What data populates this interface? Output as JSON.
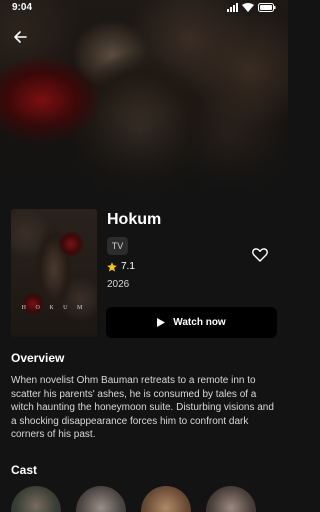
{
  "status": {
    "time": "9:04"
  },
  "movie": {
    "title": "Hokum",
    "poster_text": "H O K U M",
    "type": "TV",
    "rating": "7.1",
    "year": "2026",
    "watch_label": "Watch now"
  },
  "overview": {
    "title": "Overview",
    "text": "When novelist Ohm Bauman retreats to a remote inn to scatter his parents' ashes, he is consumed by tales of a witch haunting the honeymoon suite. Disturbing visions and a shocking disappearance forces him to confront dark corners of his past."
  },
  "cast": {
    "title": "Cast"
  },
  "colors": {
    "background": "#131313",
    "star": "#f5c518",
    "button": "#000000"
  },
  "icons": [
    "back-arrow-icon",
    "heart-icon",
    "star-icon",
    "play-icon",
    "signal-icon",
    "wifi-icon",
    "battery-icon"
  ]
}
